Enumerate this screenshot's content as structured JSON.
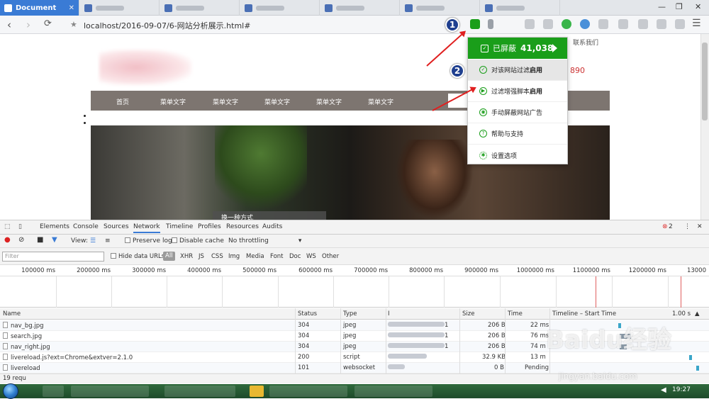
{
  "browser": {
    "active_tab": "Document",
    "url": "localhost/2016-09-07/6-网站分析展示.html#",
    "window_controls": [
      "—",
      "❐",
      "✕"
    ]
  },
  "page": {
    "nav_items": [
      "首页",
      "菜单文字",
      "菜单文字",
      "菜单文字",
      "菜单文字",
      "菜单文字"
    ],
    "contact": "联系我们",
    "phone_fragment": "890",
    "banner_caption": "换一种方式"
  },
  "popup": {
    "blocked_label": "已屏蔽",
    "blocked_count": "41,038",
    "items": [
      {
        "text": "对该网站过滤",
        "bold": "启用",
        "icon": "check-circle-icon"
      },
      {
        "text": "过滤增强脚本",
        "bold": "启用",
        "icon": "play-circle-icon"
      },
      {
        "text": "手动屏蔽网站广告",
        "bold": "",
        "icon": "target-icon"
      },
      {
        "text": "帮助与支持",
        "bold": "",
        "icon": "help-icon"
      },
      {
        "text": "设置选项",
        "bold": "",
        "icon": "gear-icon"
      }
    ]
  },
  "markers": [
    "1",
    "2"
  ],
  "devtools": {
    "tabs": [
      "Elements",
      "Console",
      "Sources",
      "Network",
      "Timeline",
      "Profiles",
      "Resources",
      "Audits"
    ],
    "active_tab": "Network",
    "error_count": "2",
    "toolbar": {
      "view_label": "View:",
      "preserve_log": "Preserve log",
      "disable_cache": "Disable cache",
      "throttling": "No throttling"
    },
    "filter": {
      "placeholder": "Filter",
      "hide_data_urls": "Hide data URLs",
      "types": [
        "All",
        "XHR",
        "JS",
        "CSS",
        "Img",
        "Media",
        "Font",
        "Doc",
        "WS",
        "Other"
      ]
    },
    "ruler": [
      "100000 ms",
      "200000 ms",
      "300000 ms",
      "400000 ms",
      "500000 ms",
      "600000 ms",
      "700000 ms",
      "800000 ms",
      "900000 ms",
      "1000000 ms",
      "1100000 ms",
      "1200000 ms",
      "13000"
    ],
    "columns": [
      "Name",
      "Status",
      "Type",
      "I",
      "Size",
      "Time",
      "Timeline – Start Time"
    ],
    "scale_label": "1.00 s",
    "rows": [
      {
        "name": "nav_bg.jpg",
        "status": "304",
        "type": "jpeg",
        "initiator": "1",
        "size": "206 B",
        "time": "22 ms"
      },
      {
        "name": "search.jpg",
        "status": "304",
        "type": "jpeg",
        "initiator": "1",
        "size": "206 B",
        "time": "76 ms"
      },
      {
        "name": "nav_right.jpg",
        "status": "304",
        "type": "jpeg",
        "initiator": "1",
        "size": "206 B",
        "time": "74 m"
      },
      {
        "name": "livereload.js?ext=Chrome&extver=2.1.0",
        "status": "200",
        "type": "script",
        "initiator": "",
        "size": "32.9 KB",
        "time": "13 m"
      },
      {
        "name": "livereload",
        "status": "101",
        "type": "websocket",
        "initiator": "",
        "size": "0 B",
        "time": "Pending"
      }
    ],
    "status_bar": "19 requ"
  },
  "taskbar": {
    "clock": "19:27"
  },
  "watermark": {
    "main": "Baidu经验",
    "sub": "jingyan.baidu.com"
  },
  "colors": {
    "accent": "#3a7bd5",
    "adblock_green": "#1a9e1a",
    "arrow_red": "#e02020",
    "marker_blue": "#1f3f8f"
  }
}
